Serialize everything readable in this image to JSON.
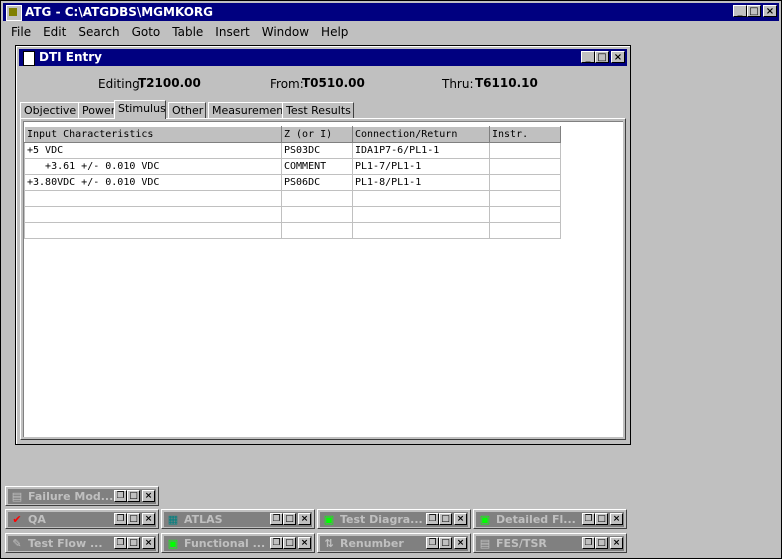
{
  "app": {
    "title": "ATG - C:\\ATGDBS\\MGMKORG",
    "menu": [
      "File",
      "Edit",
      "Search",
      "Goto",
      "Table",
      "Insert",
      "Window",
      "Help"
    ],
    "btn_min": "_",
    "btn_max": "□",
    "btn_close": "×"
  },
  "dti": {
    "title": "DTI Entry",
    "editing_label": "Editing:",
    "editing_value": "T2100.00",
    "from_label": "From:",
    "from_value": "T0510.00",
    "thru_label": "Thru:",
    "thru_value": "T6110.10",
    "tabs": [
      "Objective",
      "Power",
      "Stimulus",
      "Other",
      "Measurement",
      "Test Results"
    ],
    "active_tab": "Stimulus",
    "columns": [
      "Input Characteristics",
      "Z (or I)",
      "Connection/Return",
      "Instr."
    ],
    "rows": [
      [
        "+5 VDC",
        "PS03DC",
        "IDA1P7-6/PL1-1",
        ""
      ],
      [
        "   +3.61 +/- 0.010 VDC",
        "COMMENT",
        "PL1-7/PL1-1",
        ""
      ],
      [
        "+3.80VDC +/- 0.010 VDC",
        "PS06DC",
        "PL1-8/PL1-1",
        ""
      ],
      [
        "",
        "",
        "",
        ""
      ],
      [
        "",
        "",
        "",
        ""
      ],
      [
        "",
        "",
        "",
        ""
      ]
    ]
  },
  "minimized": [
    {
      "label": "Failure Mod...",
      "icon": "failure-icon"
    },
    {
      "label": "QA",
      "icon": "checkmark-icon"
    },
    {
      "label": "ATLAS",
      "icon": "atlas-icon"
    },
    {
      "label": "Test Diagra...",
      "icon": "diagram-icon"
    },
    {
      "label": "Detailed Fl...",
      "icon": "flow-icon"
    },
    {
      "label": "Test Flow ...",
      "icon": "testflow-icon"
    },
    {
      "label": "Functional ...",
      "icon": "functional-icon"
    },
    {
      "label": "Renumber",
      "icon": "renumber-icon"
    },
    {
      "label": "FES/TSR",
      "icon": "fes-icon"
    }
  ],
  "mini_btns": {
    "restore": "❐",
    "max": "□",
    "close": "×"
  }
}
